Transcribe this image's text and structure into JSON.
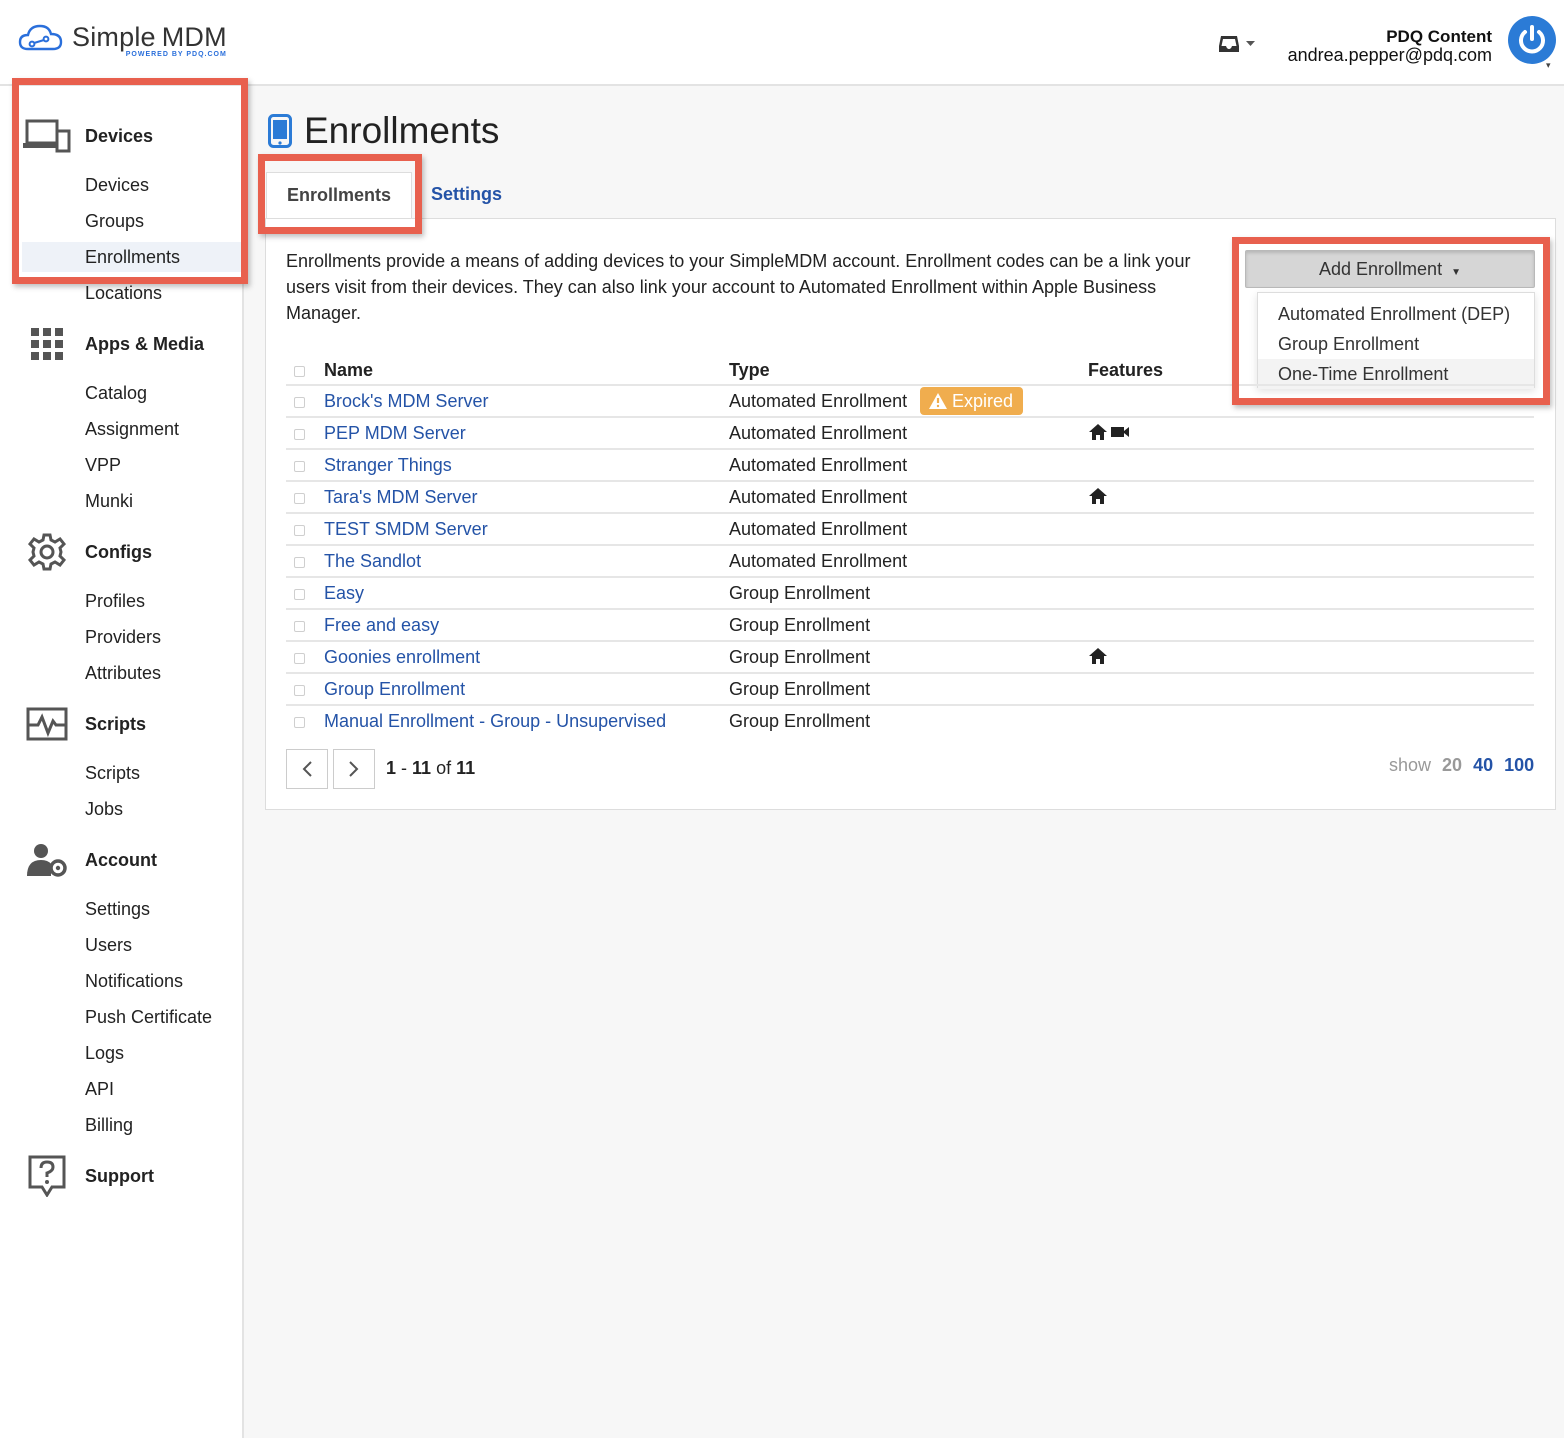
{
  "brand": {
    "name_part1": "Simple",
    "name_part2": "MDM",
    "tagline": "POWERED BY PDQ.COM"
  },
  "header": {
    "org": "PDQ Content",
    "email": "andrea.pepper@pdq.com",
    "inbox_icon": "inbox-icon",
    "avatar_icon": "power-icon"
  },
  "sidebar": {
    "sections": [
      {
        "label": "Devices",
        "icon": "devices-icon",
        "items": [
          "Devices",
          "Groups",
          "Enrollments",
          "Locations"
        ]
      },
      {
        "label": "Apps & Media",
        "icon": "grid-icon",
        "items": [
          "Catalog",
          "Assignment",
          "VPP",
          "Munki"
        ]
      },
      {
        "label": "Configs",
        "icon": "gear-icon",
        "items": [
          "Profiles",
          "Providers",
          "Attributes"
        ]
      },
      {
        "label": "Scripts",
        "icon": "pulse-icon",
        "items": [
          "Scripts",
          "Jobs"
        ]
      },
      {
        "label": "Account",
        "icon": "user-gear-icon",
        "items": [
          "Settings",
          "Users",
          "Notifications",
          "Push Certificate",
          "Logs",
          "API",
          "Billing"
        ]
      },
      {
        "label": "Support",
        "icon": "help-icon",
        "items": []
      }
    ],
    "active_item": "Enrollments"
  },
  "page": {
    "title": "Enrollments",
    "tabs": [
      "Enrollments",
      "Settings"
    ],
    "description": "Enrollments provide a means of adding devices to your SimpleMDM account. Enrollment codes can be a link your users visit from their devices. They can also link your account to Automated Enrollment within Apple Business Manager."
  },
  "add_enrollment": {
    "label": "Add Enrollment",
    "options": [
      "Automated Enrollment (DEP)",
      "Group Enrollment",
      "One-Time Enrollment"
    ],
    "highlighted_option": "One-Time Enrollment"
  },
  "table": {
    "columns": [
      "Name",
      "Type",
      "Features"
    ],
    "rows": [
      {
        "name": "Brock's MDM Server",
        "type": "Automated Enrollment",
        "badge": "Expired",
        "features": []
      },
      {
        "name": "PEP MDM Server",
        "type": "Automated Enrollment",
        "badge": "",
        "features": [
          "home-icon",
          "video-icon"
        ]
      },
      {
        "name": "Stranger Things",
        "type": "Automated Enrollment",
        "badge": "",
        "features": []
      },
      {
        "name": "Tara's MDM Server",
        "type": "Automated Enrollment",
        "badge": "",
        "features": [
          "home-icon"
        ]
      },
      {
        "name": "TEST SMDM Server",
        "type": "Automated Enrollment",
        "badge": "",
        "features": []
      },
      {
        "name": "The Sandlot",
        "type": "Automated Enrollment",
        "badge": "",
        "features": []
      },
      {
        "name": "Easy",
        "type": "Group Enrollment",
        "badge": "",
        "features": []
      },
      {
        "name": "Free and easy",
        "type": "Group Enrollment",
        "badge": "",
        "features": []
      },
      {
        "name": "Goonies enrollment",
        "type": "Group Enrollment",
        "badge": "",
        "features": [
          "home-icon"
        ]
      },
      {
        "name": "Group Enrollment",
        "type": "Group Enrollment",
        "badge": "",
        "features": []
      },
      {
        "name": "Manual Enrollment - Group - Unsupervised",
        "type": "Group Enrollment",
        "badge": "",
        "features": []
      }
    ]
  },
  "pagination": {
    "from": "1",
    "to": "11",
    "total": "11",
    "of_label": "of",
    "show_label": "show",
    "sizes": [
      "20",
      "40",
      "100"
    ],
    "current_size": "20"
  },
  "colors": {
    "accent": "#2453a7",
    "badge_warning": "#f0ad4e",
    "highlight_box": "#e8604e",
    "avatar": "#2b7bd6"
  }
}
